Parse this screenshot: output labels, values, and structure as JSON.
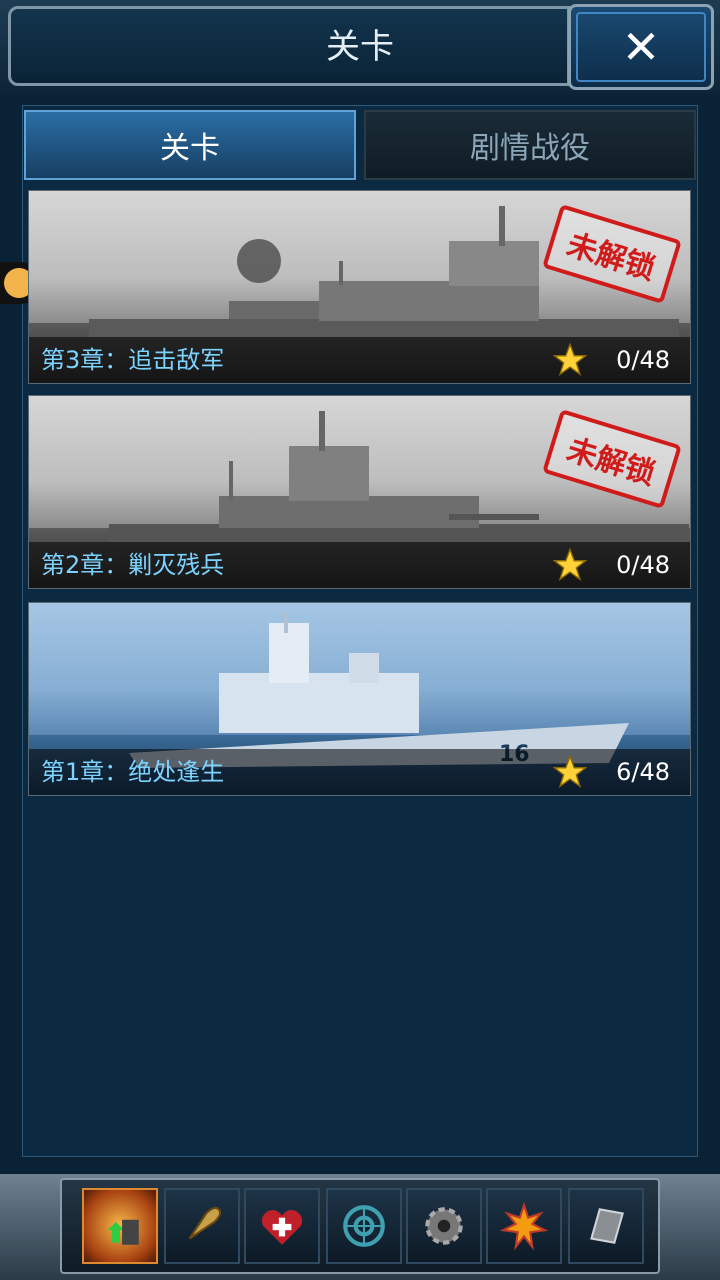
{
  "header": {
    "title": "关卡",
    "close_label": "✕"
  },
  "tabs": [
    {
      "label": "关卡",
      "active": true
    },
    {
      "label": "剧情战役",
      "active": false
    }
  ],
  "chapters": [
    {
      "name": "第3章：追击敌军",
      "progress": "0/48",
      "locked": true,
      "stamp": "未解锁"
    },
    {
      "name": "第2章：剿灭残兵",
      "progress": "0/48",
      "locked": true,
      "stamp": "未解锁"
    },
    {
      "name": "第1章：绝处逢生",
      "progress": "6/48",
      "locked": false
    }
  ],
  "toolbar": {
    "buttons": [
      "upgrade-icon",
      "shell-icon",
      "repair-icon",
      "radar-icon",
      "gear-icon",
      "explosion-icon",
      "armor-icon"
    ]
  },
  "colors": {
    "accent": "#5fa3d8",
    "chapter_text": "#7cd3ff",
    "stamp": "#d01b1b"
  }
}
